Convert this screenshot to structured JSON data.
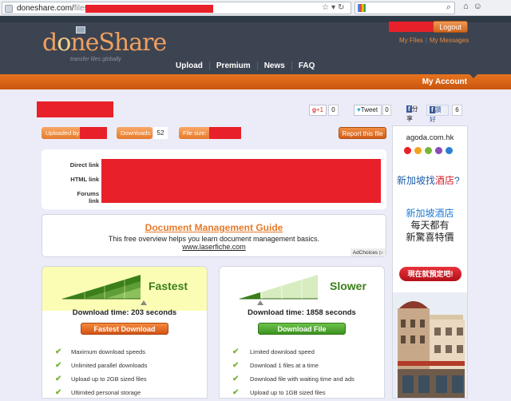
{
  "browser": {
    "url_domain": "doneshare.com/",
    "url_path": "files",
    "icons": [
      "star-icon",
      "dropdown-icon",
      "reload-icon",
      "search-icon",
      "home-icon",
      "user-icon"
    ]
  },
  "header": {
    "logo_text_a": "d",
    "logo_text_o": "o",
    "logo_text_b": "neShare",
    "tagline": "transfer files globally",
    "logout_label": "Logout",
    "my_files": "My Files",
    "my_messages": "My Messages",
    "separator": "|",
    "nav": [
      "Upload",
      "Premium",
      "News",
      "FAQ"
    ],
    "account_label": "My Account"
  },
  "social": {
    "gplus_label": "+1",
    "gplus_count": "0",
    "tweet_label": "Tweet",
    "tweet_count": "0",
    "fb_share": "分享",
    "fb_like": "讚好",
    "fb_count": "6"
  },
  "meta": {
    "uploaded_by_label": "Uploaded by:",
    "downloads_label": "Downloads:",
    "downloads_value": "52",
    "file_size_label": "File size:",
    "report_label": "Report this file"
  },
  "links": {
    "direct": "Direct link",
    "html": "HTML link",
    "forums": "Forums link"
  },
  "ad": {
    "title": "Document Management Guide",
    "body": "This free overview helps you learn document management basics.",
    "url": "www.laserfiche.com",
    "adchoices": "AdChoices"
  },
  "download": {
    "fast": {
      "word": "Fastest",
      "time": "Download time: 203 seconds",
      "button": "Fastest Download",
      "features": [
        "Maximum download speeds",
        "Unlimited parallel downloads",
        "Upload up to 2GB sized files",
        "Ultimited personal storage"
      ]
    },
    "slow": {
      "word": "Slower",
      "time": "Download time: 1858 seconds",
      "button": "Download File",
      "features": [
        "Limited download speed",
        "Download 1 files at a time",
        "Download file with waiting time and ads",
        "Upload up to 1GB sized files"
      ]
    }
  },
  "side_ad": {
    "brand": "agoda.com.hk",
    "question_a": "新加坡找",
    "question_hl": "酒店",
    "question_b": "?",
    "h1": "新加坡酒店",
    "h2": "每天都有",
    "h3": "新驚喜特價",
    "button": "現在就預定吧!",
    "dot_colors": [
      "#e8202a",
      "#f2a31b",
      "#7ab53a",
      "#8a4bb5",
      "#2a7fd4"
    ]
  },
  "colors": {
    "accent_orange": "#e8731f",
    "header_dark": "#3d4451",
    "green": "#3a7f1a"
  }
}
